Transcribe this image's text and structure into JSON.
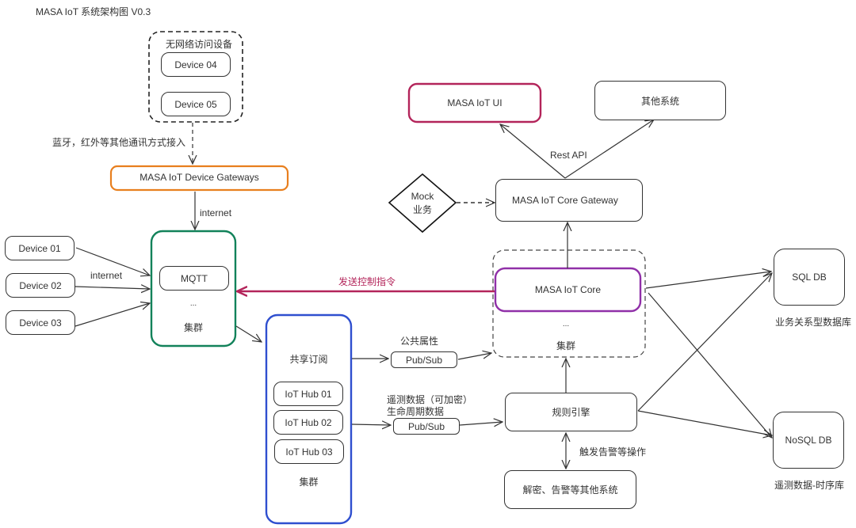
{
  "title": "MASA IoT 系统架构图 V0.3",
  "colors": {
    "gateway": "#e87f1e",
    "mqtt_cluster": "#12825a",
    "hub_cluster": "#2f4fcf",
    "ui": "#b3245a",
    "core": "#9030a8",
    "control_arrow": "#b3245a",
    "line": "#333333"
  },
  "offline_devices": {
    "group_label": "无网络访问设备",
    "devices": [
      "Device 04",
      "Device 05"
    ],
    "connection_label": "蓝牙，红外等其他通讯方式接入"
  },
  "device_gateway": {
    "label": "MASA IoT Device Gateways",
    "link_label": "internet"
  },
  "online_devices": {
    "devices": [
      "Device 01",
      "Device 02",
      "Device 03"
    ],
    "link_label": "internet"
  },
  "mqtt_cluster": {
    "node": "MQTT",
    "ellipsis": "...",
    "cluster_label": "集群"
  },
  "control_command": {
    "label": "发送控制指令"
  },
  "hub_cluster": {
    "shared_subscription": "共享订阅",
    "hubs": [
      "IoT Hub 01",
      "IoT Hub 02",
      "IoT Hub 03"
    ],
    "cluster_label": "集群"
  },
  "pubsub_public": {
    "label": "Pub/Sub",
    "topic_label": "公共属性"
  },
  "pubsub_telemetry": {
    "label": "Pub/Sub",
    "topic_label_1": "遥测数据（可加密）",
    "topic_label_2": "生命周期数据"
  },
  "core_cluster": {
    "node": "MASA IoT Core",
    "ellipsis": "...",
    "cluster_label": "集群"
  },
  "core_gateway": {
    "label": "MASA IoT Core Gateway",
    "api_label": "Rest API"
  },
  "mock": {
    "line1": "Mock",
    "line2": "业务"
  },
  "ui": {
    "label": "MASA IoT UI"
  },
  "other_systems": {
    "label": "其他系统"
  },
  "rule_engine": {
    "label": "规则引擎",
    "trigger_label": "触发告警等操作"
  },
  "decrypt_alarm": {
    "label": "解密、告警等其他系统"
  },
  "sql_db": {
    "label": "SQL DB",
    "caption": "业务关系型数据库"
  },
  "nosql_db": {
    "label": "NoSQL DB",
    "caption": "遥测数据-时序库"
  }
}
